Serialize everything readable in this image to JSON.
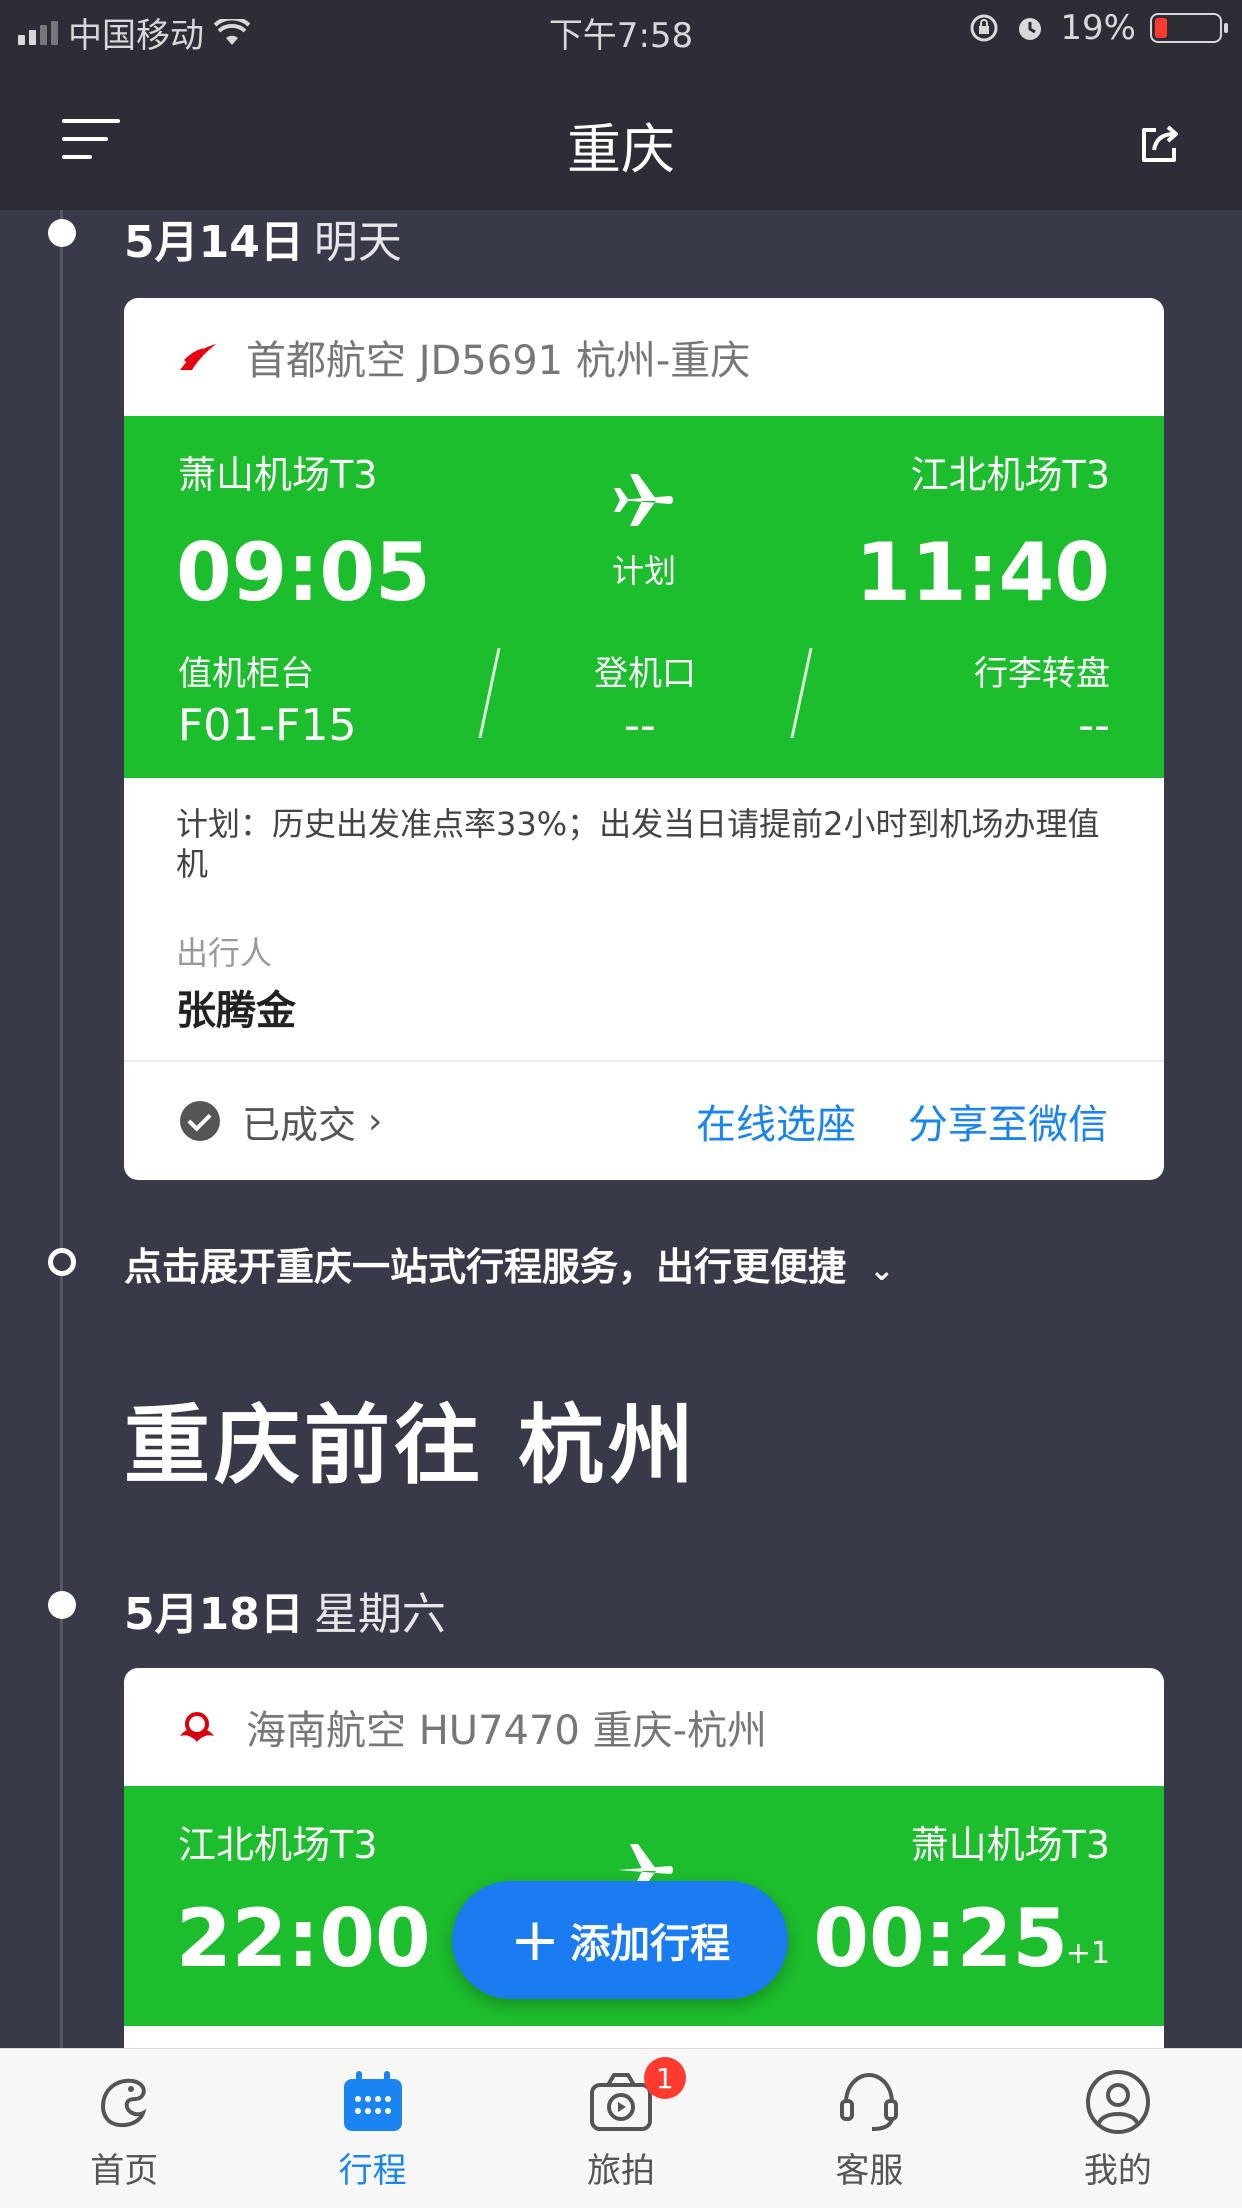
{
  "status_bar": {
    "carrier": "中国移动",
    "time": "下午7:58",
    "battery": "19%",
    "battery_level": 0.19
  },
  "header": {
    "title": "重庆"
  },
  "trip1": {
    "date": "5月14日",
    "weekday": "明天",
    "airline": "首都航空 JD5691 杭州-重庆",
    "dep_airport": "萧山机场T3",
    "arr_airport": "江北机场T3",
    "dep_time": "09:05",
    "arr_time": "11:40",
    "status": "计划",
    "checkin_label": "值机柜台",
    "checkin_value": "F01-F15",
    "gate_label": "登机口",
    "gate_value": "--",
    "baggage_label": "行李转盘",
    "baggage_value": "--",
    "note": "计划：历史出发准点率33%；出发当日请提前2小时到机场办理值机",
    "passenger_label": "出行人",
    "passenger_name": "张腾金",
    "order_status": "已成交",
    "seat_link": "在线选座",
    "share_link": "分享至微信"
  },
  "expand_text": "点击展开重庆一站式行程服务，出行更便捷",
  "route": {
    "title": "重庆前往 杭州"
  },
  "trip2": {
    "date": "5月18日",
    "weekday": "星期六",
    "airline": "海南航空 HU7470 重庆-杭州",
    "dep_airport": "江北机场T3",
    "arr_airport": "萧山机场T3",
    "dep_time": "22:00",
    "arr_time": "00:25",
    "day_offset": "+1"
  },
  "add_button": {
    "label": "添加行程"
  },
  "tabs": [
    {
      "label": "首页",
      "icon": "dolphin-icon"
    },
    {
      "label": "行程",
      "icon": "calendar-icon"
    },
    {
      "label": "旅拍",
      "icon": "camera-icon",
      "badge": "1"
    },
    {
      "label": "客服",
      "icon": "headset-icon"
    },
    {
      "label": "我的",
      "icon": "user-icon"
    }
  ],
  "colors": {
    "green": "#1dbe2e",
    "blue": "#1a84f0",
    "background": "#383a49",
    "header": "#2c2d36"
  }
}
